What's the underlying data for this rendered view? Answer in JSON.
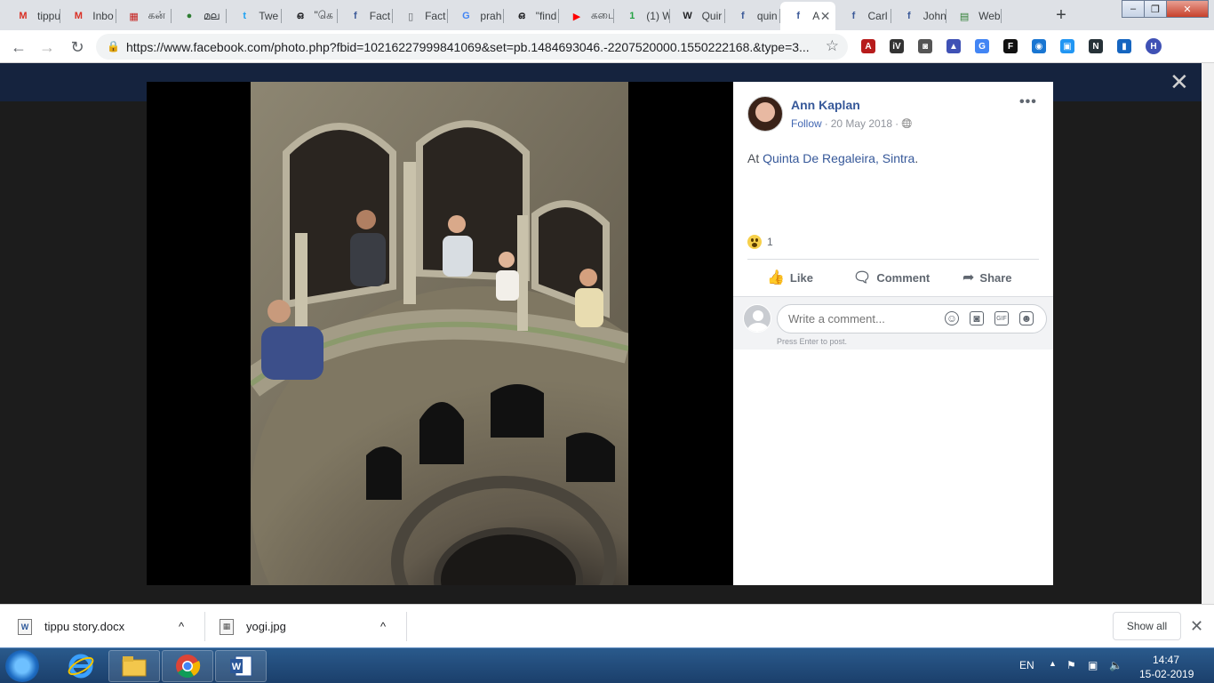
{
  "tabs": [
    {
      "icon": "gmail-icon",
      "label": "tippu",
      "color": "#d93025",
      "glyph": "M"
    },
    {
      "icon": "gmail-icon",
      "label": "Inbo",
      "color": "#d93025",
      "glyph": "M"
    },
    {
      "icon": "news-icon",
      "label": "கன்",
      "color": "#c5221f",
      "glyph": "▦"
    },
    {
      "icon": "globe-icon",
      "label": "മല",
      "color": "#2e7d32",
      "glyph": "●"
    },
    {
      "icon": "twitter-icon",
      "label": "Twe",
      "color": "#1da1f2",
      "glyph": "t"
    },
    {
      "icon": "malayalam-icon",
      "label": "\"கெ",
      "color": "#202124",
      "glyph": "ഒ"
    },
    {
      "icon": "facebook-icon",
      "label": "Fact",
      "color": "#3b5998",
      "glyph": "f"
    },
    {
      "icon": "document-icon",
      "label": "Fact",
      "color": "#5f6368",
      "glyph": "▯"
    },
    {
      "icon": "google-icon",
      "label": "prah",
      "color": "#4285f4",
      "glyph": "G"
    },
    {
      "icon": "malayalam-icon",
      "label": "\"find",
      "color": "#202124",
      "glyph": "ഒ"
    },
    {
      "icon": "youtube-icon",
      "label": "கடை",
      "color": "#ff0000",
      "glyph": "▶"
    },
    {
      "icon": "whatsapp-icon",
      "label": "(1) W",
      "color": "#25a244",
      "glyph": "1"
    },
    {
      "icon": "wikipedia-icon",
      "label": "Quir",
      "color": "#202124",
      "glyph": "W"
    },
    {
      "icon": "facebook-icon",
      "label": "quin",
      "color": "#3b5998",
      "glyph": "f"
    },
    {
      "icon": "facebook-icon",
      "label": "A",
      "color": "#3b5998",
      "glyph": "f",
      "active": true
    },
    {
      "icon": "facebook-icon",
      "label": "Carl",
      "color": "#3b5998",
      "glyph": "f"
    },
    {
      "icon": "facebook-icon",
      "label": "John",
      "color": "#3b5998",
      "glyph": "f"
    },
    {
      "icon": "web-icon",
      "label": "Web",
      "color": "#2e7d32",
      "glyph": "▤"
    }
  ],
  "window_controls": {
    "minimize": "–",
    "maximize": "❐",
    "close": "✕"
  },
  "toolbar": {
    "back": "←",
    "forward": "→",
    "reload": "↻",
    "url": "https://www.facebook.com/photo.php?fbid=10216227999841069&set=pb.1484693046.-2207520000.1550222168.&type=3...",
    "star": "☆",
    "extensions": [
      {
        "name": "pdf-extension-icon",
        "glyph": "A",
        "color": "#b71c1c"
      },
      {
        "name": "invid-extension-icon",
        "glyph": "iV",
        "color": "#333333"
      },
      {
        "name": "camera-extension-icon",
        "glyph": "◙",
        "color": "#555555"
      },
      {
        "name": "image-extension-icon",
        "glyph": "▲",
        "color": "#3f51b5"
      },
      {
        "name": "translate-extension-icon",
        "glyph": "G",
        "color": "#4285f4"
      },
      {
        "name": "f-extension-icon",
        "glyph": "F",
        "color": "#111111"
      },
      {
        "name": "target-extension-icon",
        "glyph": "◉",
        "color": "#1976d2"
      },
      {
        "name": "window-extension-icon",
        "glyph": "▣",
        "color": "#2196f3"
      },
      {
        "name": "n-extension-icon",
        "glyph": "N",
        "color": "#263238"
      },
      {
        "name": "bookmark-extension-icon",
        "glyph": "▮",
        "color": "#1565c0"
      },
      {
        "name": "profile-avatar-icon",
        "glyph": "H",
        "color": "#3f51b5"
      }
    ]
  },
  "overlay": {
    "close": "✕"
  },
  "post": {
    "author": "Ann Kaplan",
    "follow": "Follow",
    "separator": "·",
    "date": "20 May 2018",
    "audience_icon": "🌐",
    "more": "•••",
    "status_prefix": "At",
    "place": "Quinta De Regaleira, Sintra",
    "status_suffix": ".",
    "reaction_count": "1",
    "actions": {
      "like": "Like",
      "comment": "Comment",
      "share": "Share"
    },
    "comment_placeholder": "Write a comment...",
    "press_enter": "Press Enter to post."
  },
  "downloads": {
    "items": [
      {
        "filename": "tippu story.docx",
        "type_glyph": "W"
      },
      {
        "filename": "yogi.jpg",
        "type_glyph": "▦"
      }
    ],
    "chevron": "^",
    "show_all": "Show all",
    "close": "✕"
  },
  "taskbar": {
    "lang": "EN",
    "time": "14:47",
    "date": "15-02-2019"
  }
}
